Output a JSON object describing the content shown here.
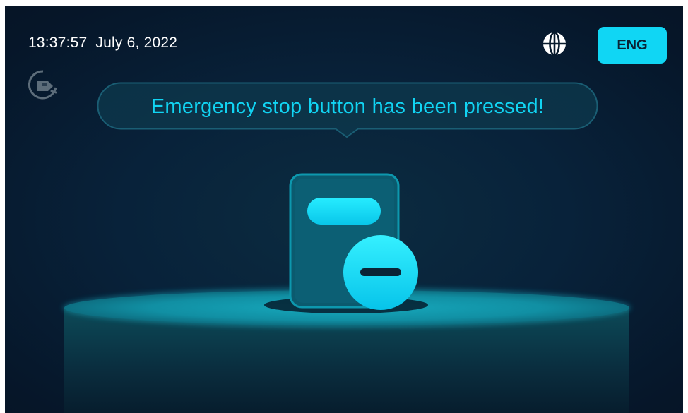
{
  "status_bar": {
    "time": "13:37:57",
    "date": "July 6, 2022",
    "globe_icon": "globe-icon",
    "language_button_label": "ENG"
  },
  "connection": {
    "icon": "charger-plug-disconnected-icon"
  },
  "alert": {
    "message": "Emergency stop button has been pressed!",
    "illustration_icon": "emergency-stop-device-icon"
  },
  "colors": {
    "accent": "#10d6f4",
    "background": "#061629",
    "text": "#ffffff"
  }
}
